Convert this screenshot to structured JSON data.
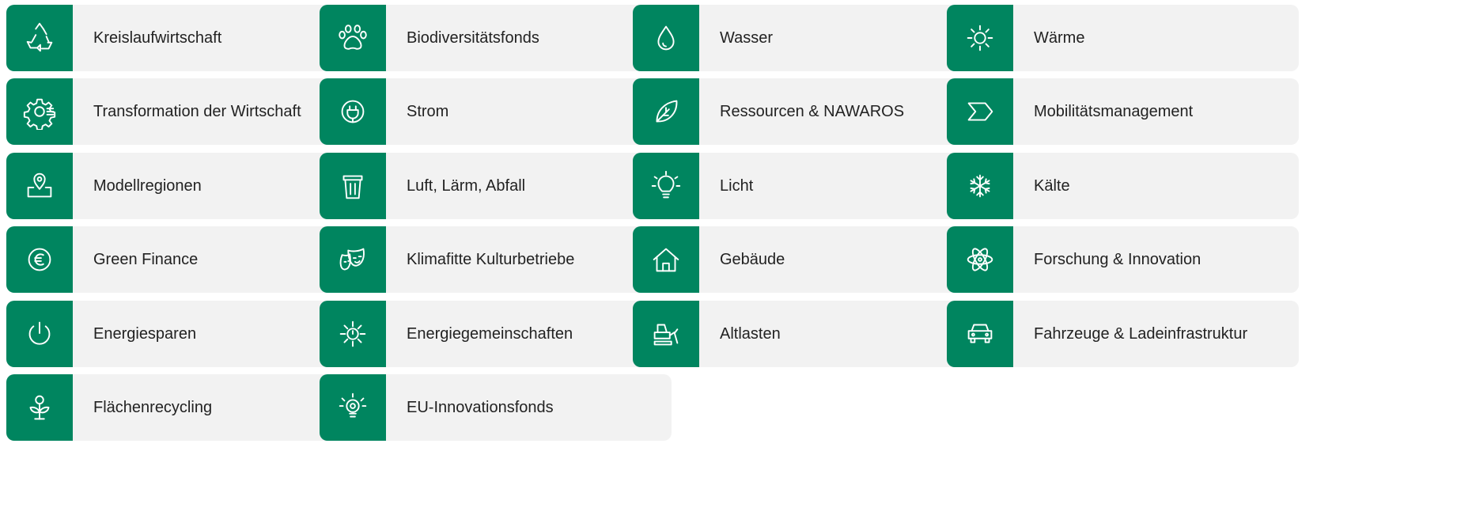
{
  "accent_color": "#00855f",
  "tile_background": "#f2f2f2",
  "tiles": [
    {
      "label": "Kreislaufwirtschaft",
      "icon": "recycle-icon"
    },
    {
      "label": "Biodiversitätsfonds",
      "icon": "paw-icon"
    },
    {
      "label": "Wasser",
      "icon": "water-drop-icon"
    },
    {
      "label": "Wärme",
      "icon": "sun-icon"
    },
    {
      "label": "Transformation der Wirtschaft",
      "icon": "gear-icon"
    },
    {
      "label": "Strom",
      "icon": "power-plug-icon"
    },
    {
      "label": "Ressourcen & NAWAROS",
      "icon": "leaf-icon"
    },
    {
      "label": "Mobilitätsmanagement",
      "icon": "arrow-chevron-icon"
    },
    {
      "label": "Modellregionen",
      "icon": "map-pin-icon"
    },
    {
      "label": "Luft, Lärm, Abfall",
      "icon": "trash-can-icon"
    },
    {
      "label": "Licht",
      "icon": "light-bulb-icon"
    },
    {
      "label": "Kälte",
      "icon": "snowflake-icon"
    },
    {
      "label": "Green Finance",
      "icon": "euro-coin-icon"
    },
    {
      "label": "Klimafitte Kulturbetriebe",
      "icon": "theater-masks-icon"
    },
    {
      "label": "Gebäude",
      "icon": "house-icon"
    },
    {
      "label": "Forschung & Innovation",
      "icon": "atom-icon"
    },
    {
      "label": "Energiesparen",
      "icon": "power-button-icon"
    },
    {
      "label": "Energiegemeinschaften",
      "icon": "sun-rays-icon"
    },
    {
      "label": "Altlasten",
      "icon": "bulldozer-icon"
    },
    {
      "label": "Fahrzeuge & Ladeinfrastruktur",
      "icon": "car-icon"
    },
    {
      "label": "Flächenrecycling",
      "icon": "sprout-icon"
    },
    {
      "label": "EU-Innovationsfonds",
      "icon": "innovation-bulb-icon"
    }
  ]
}
